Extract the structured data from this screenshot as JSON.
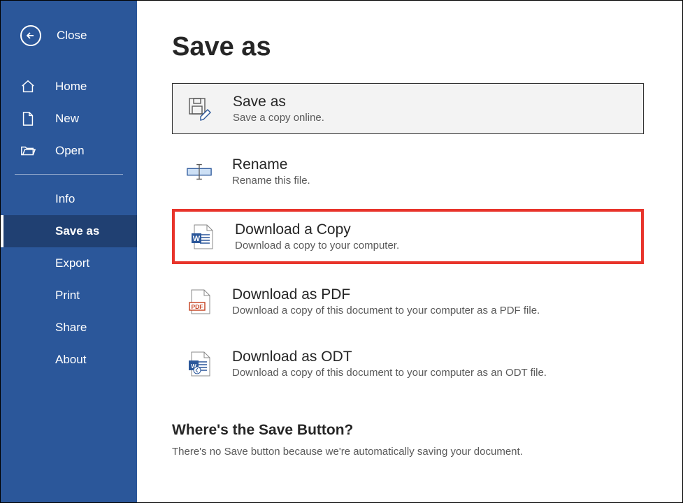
{
  "sidebar": {
    "close": "Close",
    "primary": [
      {
        "icon": "home-icon",
        "label": "Home"
      },
      {
        "icon": "new-icon",
        "label": "New"
      },
      {
        "icon": "open-icon",
        "label": "Open"
      }
    ],
    "secondary": [
      {
        "label": "Info"
      },
      {
        "label": "Save as",
        "active": true
      },
      {
        "label": "Export"
      },
      {
        "label": "Print"
      },
      {
        "label": "Share"
      },
      {
        "label": "About"
      }
    ]
  },
  "main": {
    "title": "Save as",
    "options": [
      {
        "icon": "save-as-icon",
        "title": "Save as",
        "desc": "Save a copy online.",
        "boxed": true
      },
      {
        "icon": "rename-icon",
        "title": "Rename",
        "desc": "Rename this file."
      },
      {
        "icon": "word-doc-icon",
        "title": "Download a Copy",
        "desc": "Download a copy to your computer.",
        "highlighted": true
      },
      {
        "icon": "pdf-icon",
        "title": "Download as PDF",
        "desc": "Download a copy of this document to your computer as a PDF file."
      },
      {
        "icon": "odt-icon",
        "title": "Download as ODT",
        "desc": "Download a copy of this document to your computer as an ODT file."
      }
    ],
    "footer": {
      "title": "Where's the Save Button?",
      "desc": "There's no Save button because we're automatically saving your document."
    }
  }
}
